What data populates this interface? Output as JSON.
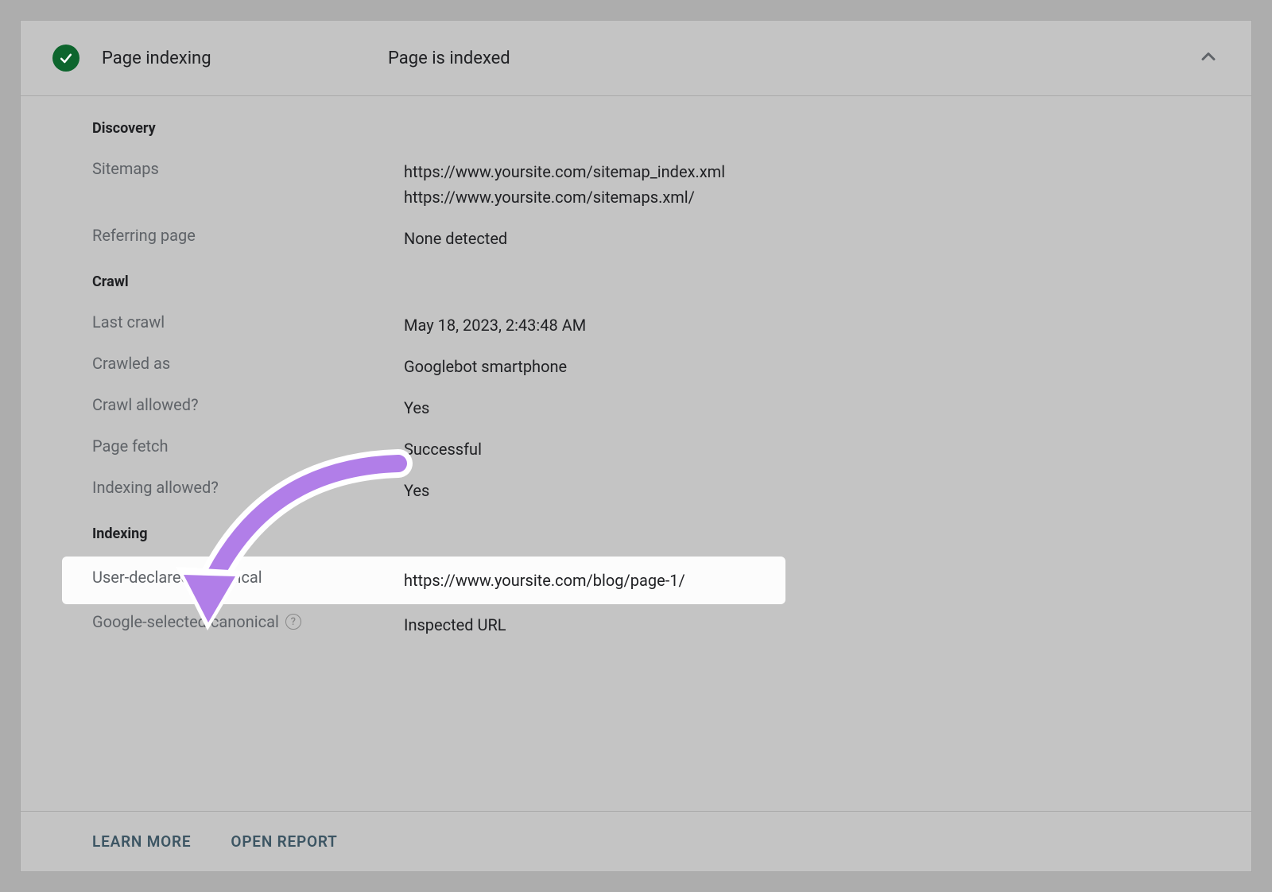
{
  "header": {
    "title": "Page indexing",
    "status": "Page is indexed"
  },
  "sections": {
    "discovery": {
      "heading": "Discovery",
      "sitemaps": {
        "label": "Sitemaps",
        "value1": "https://www.yoursite.com/sitemap_index.xml",
        "value2": "https://www.yoursite.com/sitemaps.xml/"
      },
      "referring_page": {
        "label": "Referring page",
        "value": "None detected"
      }
    },
    "crawl": {
      "heading": "Crawl",
      "last_crawl": {
        "label": "Last crawl",
        "value": "May 18, 2023, 2:43:48 AM"
      },
      "crawled_as": {
        "label": "Crawled as",
        "value": "Googlebot smartphone"
      },
      "crawl_allowed": {
        "label": "Crawl allowed?",
        "value": "Yes"
      },
      "page_fetch": {
        "label": "Page fetch",
        "value": "Successful"
      },
      "indexing_allowed": {
        "label": "Indexing allowed?",
        "value": "Yes"
      }
    },
    "indexing": {
      "heading": "Indexing",
      "user_canonical": {
        "label": "User-declared canonical",
        "value": "https://www.yoursite.com/blog/page-1/"
      },
      "google_canonical": {
        "label": "Google-selected canonical",
        "value": "Inspected URL"
      }
    }
  },
  "footer": {
    "learn_more": "LEARN MORE",
    "open_report": "OPEN REPORT"
  }
}
